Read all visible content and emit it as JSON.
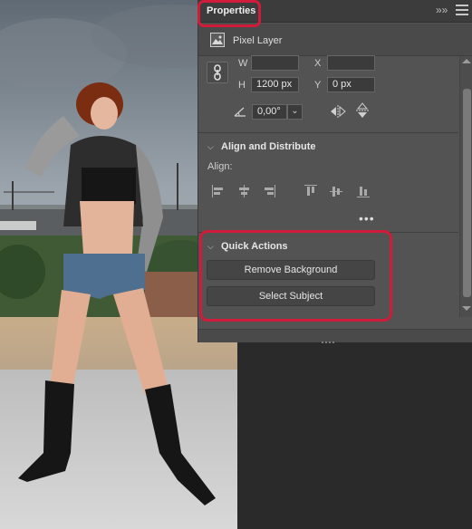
{
  "panel": {
    "title": "Properties",
    "collapse_icon": "double-chevron-right-icon",
    "menu_icon": "hamburger-menu-icon",
    "layer_type": "Pixel Layer"
  },
  "transform": {
    "w_label": "W",
    "w_value": "",
    "x_label": "X",
    "x_value": "",
    "h_label": "H",
    "h_value": "1200 px",
    "y_label": "Y",
    "y_value": "0 px",
    "angle_value": "0,00°"
  },
  "align_section": {
    "title": "Align and Distribute",
    "align_label": "Align:",
    "buttons": [
      "align-left-edges",
      "align-horizontal-centers",
      "align-right-edges",
      "align-top-edges",
      "align-vertical-centers",
      "align-bottom-edges"
    ]
  },
  "quick_actions": {
    "title": "Quick Actions",
    "remove_background": "Remove Background",
    "select_subject": "Select Subject"
  },
  "colors": {
    "panel_bg": "#535353",
    "header_bg": "#3c3c3c",
    "highlight": "#d01c3a",
    "button_bg": "#454545"
  }
}
